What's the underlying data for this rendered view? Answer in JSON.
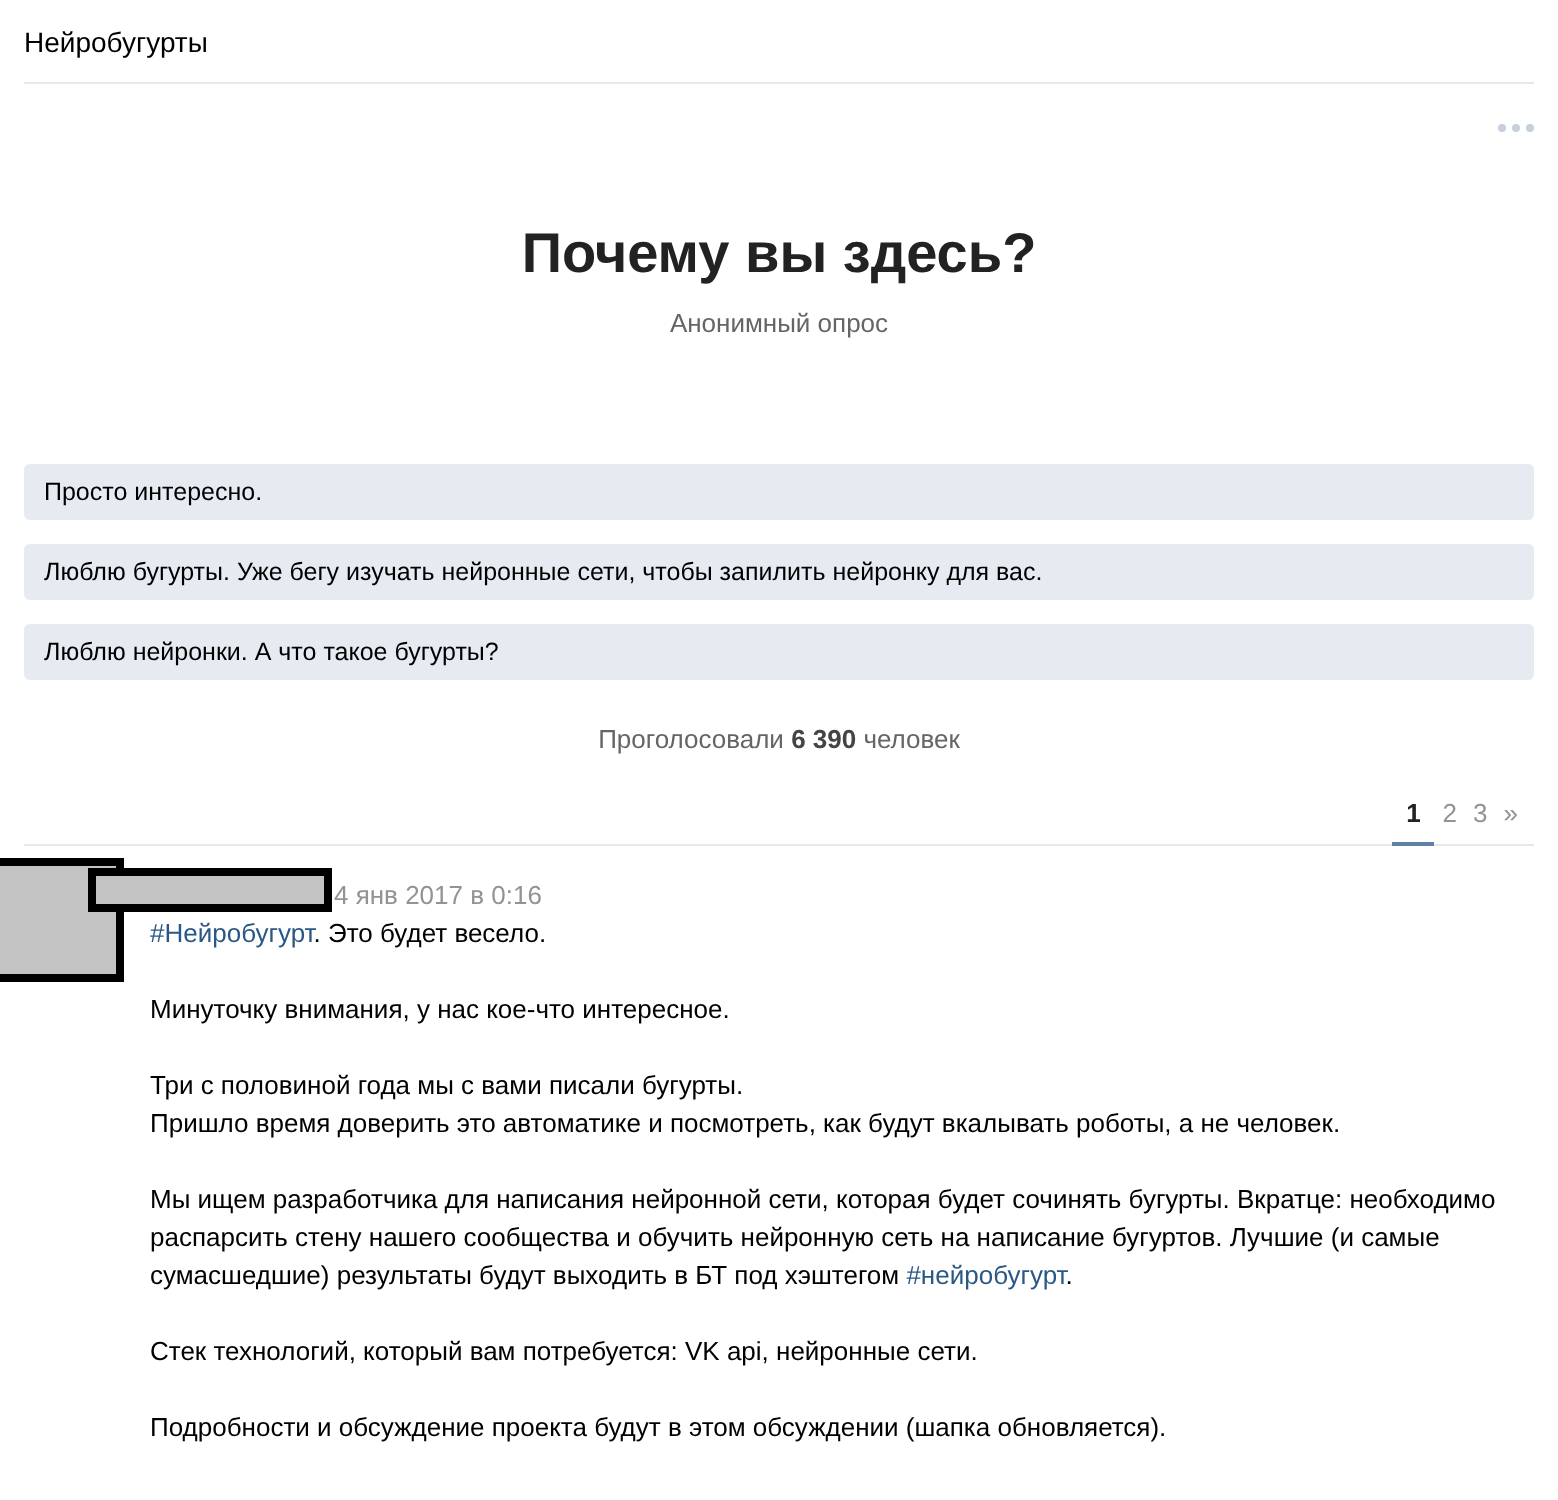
{
  "page_title": "Нейробугурты",
  "poll": {
    "title": "Почему вы здесь?",
    "subtitle": "Анонимный опрос",
    "options": [
      {
        "label": "Просто интересно."
      },
      {
        "label": "Люблю бугурты. Уже бегу изучать нейронные сети, чтобы запилить нейронку для вас."
      },
      {
        "label": "Люблю нейронки. А что такое бугурты?"
      }
    ],
    "voted": "Проголосовали **6 390** человек"
  },
  "pagination": [
    {
      "label": "1",
      "selected": true
    },
    {
      "label": "2",
      "selected": false
    },
    {
      "label": "3",
      "selected": false
    },
    {
      "label": "»",
      "selected": false
    }
  ],
  "post": {
    "date": "4 янв 2017 в 0:16",
    "paragraphs": [
      [
        [
          {
            "kind": "link",
            "text": "#Нейробугурт"
          },
          {
            "kind": "text",
            "text": ". Это будет весело."
          }
        ]
      ],
      [
        [
          {
            "kind": "text",
            "text": "Минуточку внимания, у нас кое-что интересное."
          }
        ]
      ],
      [
        [
          {
            "kind": "text",
            "text": "Три с половиной года мы с вами писали бугурты."
          }
        ],
        [
          {
            "kind": "text",
            "text": "Пришло время доверить это автоматике и посмотреть, как будут вкалывать роботы, а не человек."
          }
        ]
      ],
      [
        [
          {
            "kind": "text",
            "text": "Мы ищем разработчика для написания нейронной сети, которая будет сочинять бугурты. Вкратце: необходимо распарсить стену нашего сообщества и обучить нейронную сеть на написание бугуртов. Лучшие (и самые сумасшедшие) результаты будут выходить в БТ под хэштегом "
          },
          {
            "kind": "link",
            "text": "#нейробугурт"
          },
          {
            "kind": "text",
            "text": "."
          }
        ]
      ],
      [
        [
          {
            "kind": "text",
            "text": "Стек технологий, который вам потребуется: VK api, нейронные сети."
          }
        ]
      ],
      [
        [
          {
            "kind": "text",
            "text": "Подробности и обсуждение проекта будут в этом обсуждении (шапка обновляется)."
          }
        ]
      ]
    ]
  }
}
